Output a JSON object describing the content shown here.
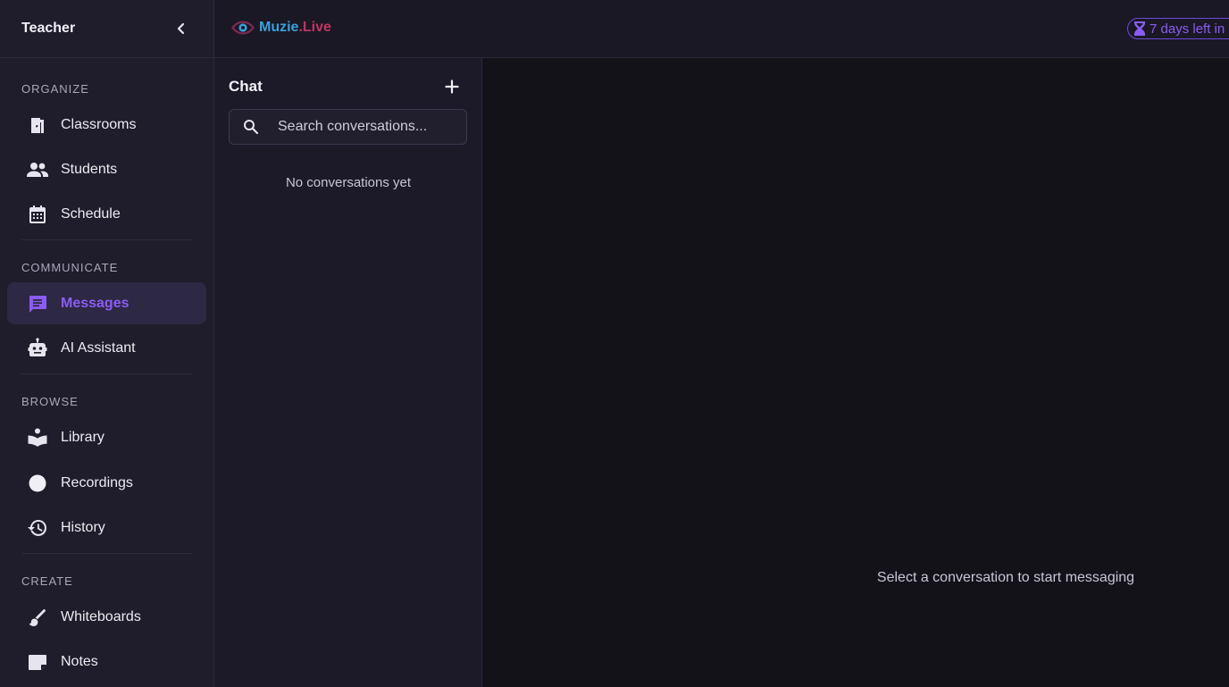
{
  "sidebar": {
    "title": "Teacher",
    "sections": {
      "organize": "ORGANIZE",
      "communicate": "COMMUNICATE",
      "browse": "BROWSE",
      "create": "CREATE"
    },
    "items": [
      {
        "label": "Classrooms",
        "icon": "door-icon"
      },
      {
        "label": "Students",
        "icon": "people-icon"
      },
      {
        "label": "Schedule",
        "icon": "calendar-icon"
      },
      {
        "label": "Messages",
        "icon": "message-icon",
        "active": true
      },
      {
        "label": "AI Assistant",
        "icon": "robot-icon"
      },
      {
        "label": "Library",
        "icon": "book-icon"
      },
      {
        "label": "Recordings",
        "icon": "record-icon"
      },
      {
        "label": "History",
        "icon": "history-icon"
      },
      {
        "label": "Whiteboards",
        "icon": "brush-icon"
      },
      {
        "label": "Notes",
        "icon": "note-icon"
      }
    ]
  },
  "topbar": {
    "logo_main": "Muzie",
    "logo_accent": ".Live",
    "trial_text": "7 days left in"
  },
  "chat": {
    "title": "Chat",
    "search_placeholder": "Search conversations...",
    "empty_text": "No conversations yet"
  },
  "main": {
    "hint": "Select a conversation to start messaging"
  },
  "colors": {
    "accent": "#8a5cf5",
    "sidebar_bg": "#1f1d2c",
    "main_bg": "#131219",
    "logo_blue": "#3aa0d8",
    "logo_red": "#c0355f"
  }
}
